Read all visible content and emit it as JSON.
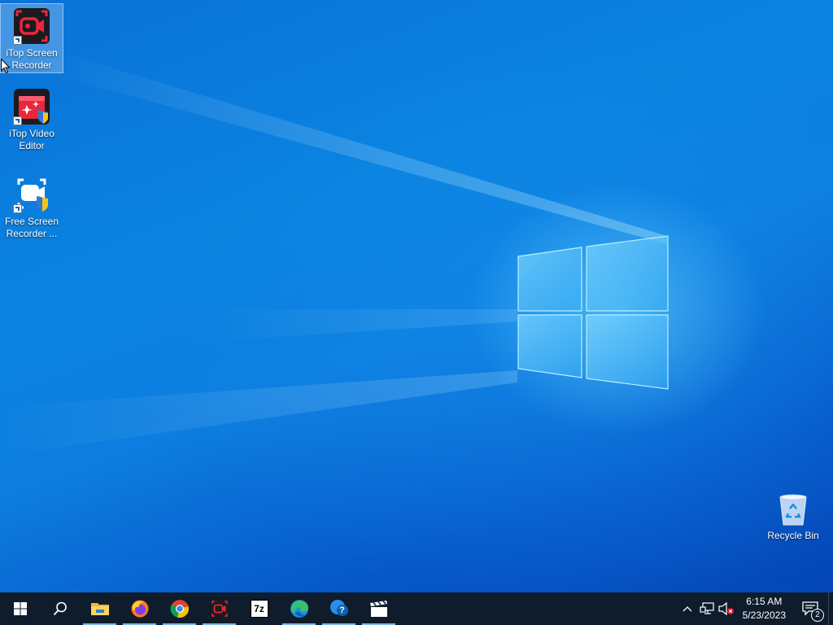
{
  "desktop": {
    "icons": [
      {
        "label": "iTop Screen Recorder",
        "icon": "itop-screen-recorder-icon",
        "selected": true
      },
      {
        "label": "iTop Video Editor",
        "icon": "itop-video-editor-icon",
        "selected": false
      },
      {
        "label": "Free Screen Recorder ...",
        "icon": "free-screen-recorder-icon",
        "selected": false
      },
      {
        "label": "Recycle Bin",
        "icon": "recycle-bin-icon",
        "selected": false
      }
    ]
  },
  "taskbar": {
    "items": [
      {
        "name": "start",
        "icon": "windows-logo-icon",
        "running": false
      },
      {
        "name": "search",
        "icon": "search-icon",
        "running": false
      },
      {
        "name": "file-explorer",
        "icon": "folder-icon",
        "running": true
      },
      {
        "name": "firefox",
        "icon": "firefox-icon",
        "running": true
      },
      {
        "name": "chrome",
        "icon": "chrome-icon",
        "running": true
      },
      {
        "name": "itop-screen-recorder",
        "icon": "itop-screen-recorder-icon",
        "running": true
      },
      {
        "name": "7-zip",
        "icon": "7zip-icon",
        "running": false
      },
      {
        "name": "edge",
        "icon": "edge-icon",
        "running": true
      },
      {
        "name": "get-help",
        "icon": "get-help-icon",
        "running": true
      },
      {
        "name": "video-editor",
        "icon": "clapperboard-icon",
        "running": true
      }
    ],
    "sevenzip_text": "7z",
    "help_text": "?",
    "tray": {
      "time": "6:15 AM",
      "date": "5/23/2023",
      "notification_count": "2"
    }
  },
  "colors": {
    "desktop_blue": "#0a7fe0",
    "taskbar": "#0e1c2c",
    "itop_red": "#e8263c"
  }
}
